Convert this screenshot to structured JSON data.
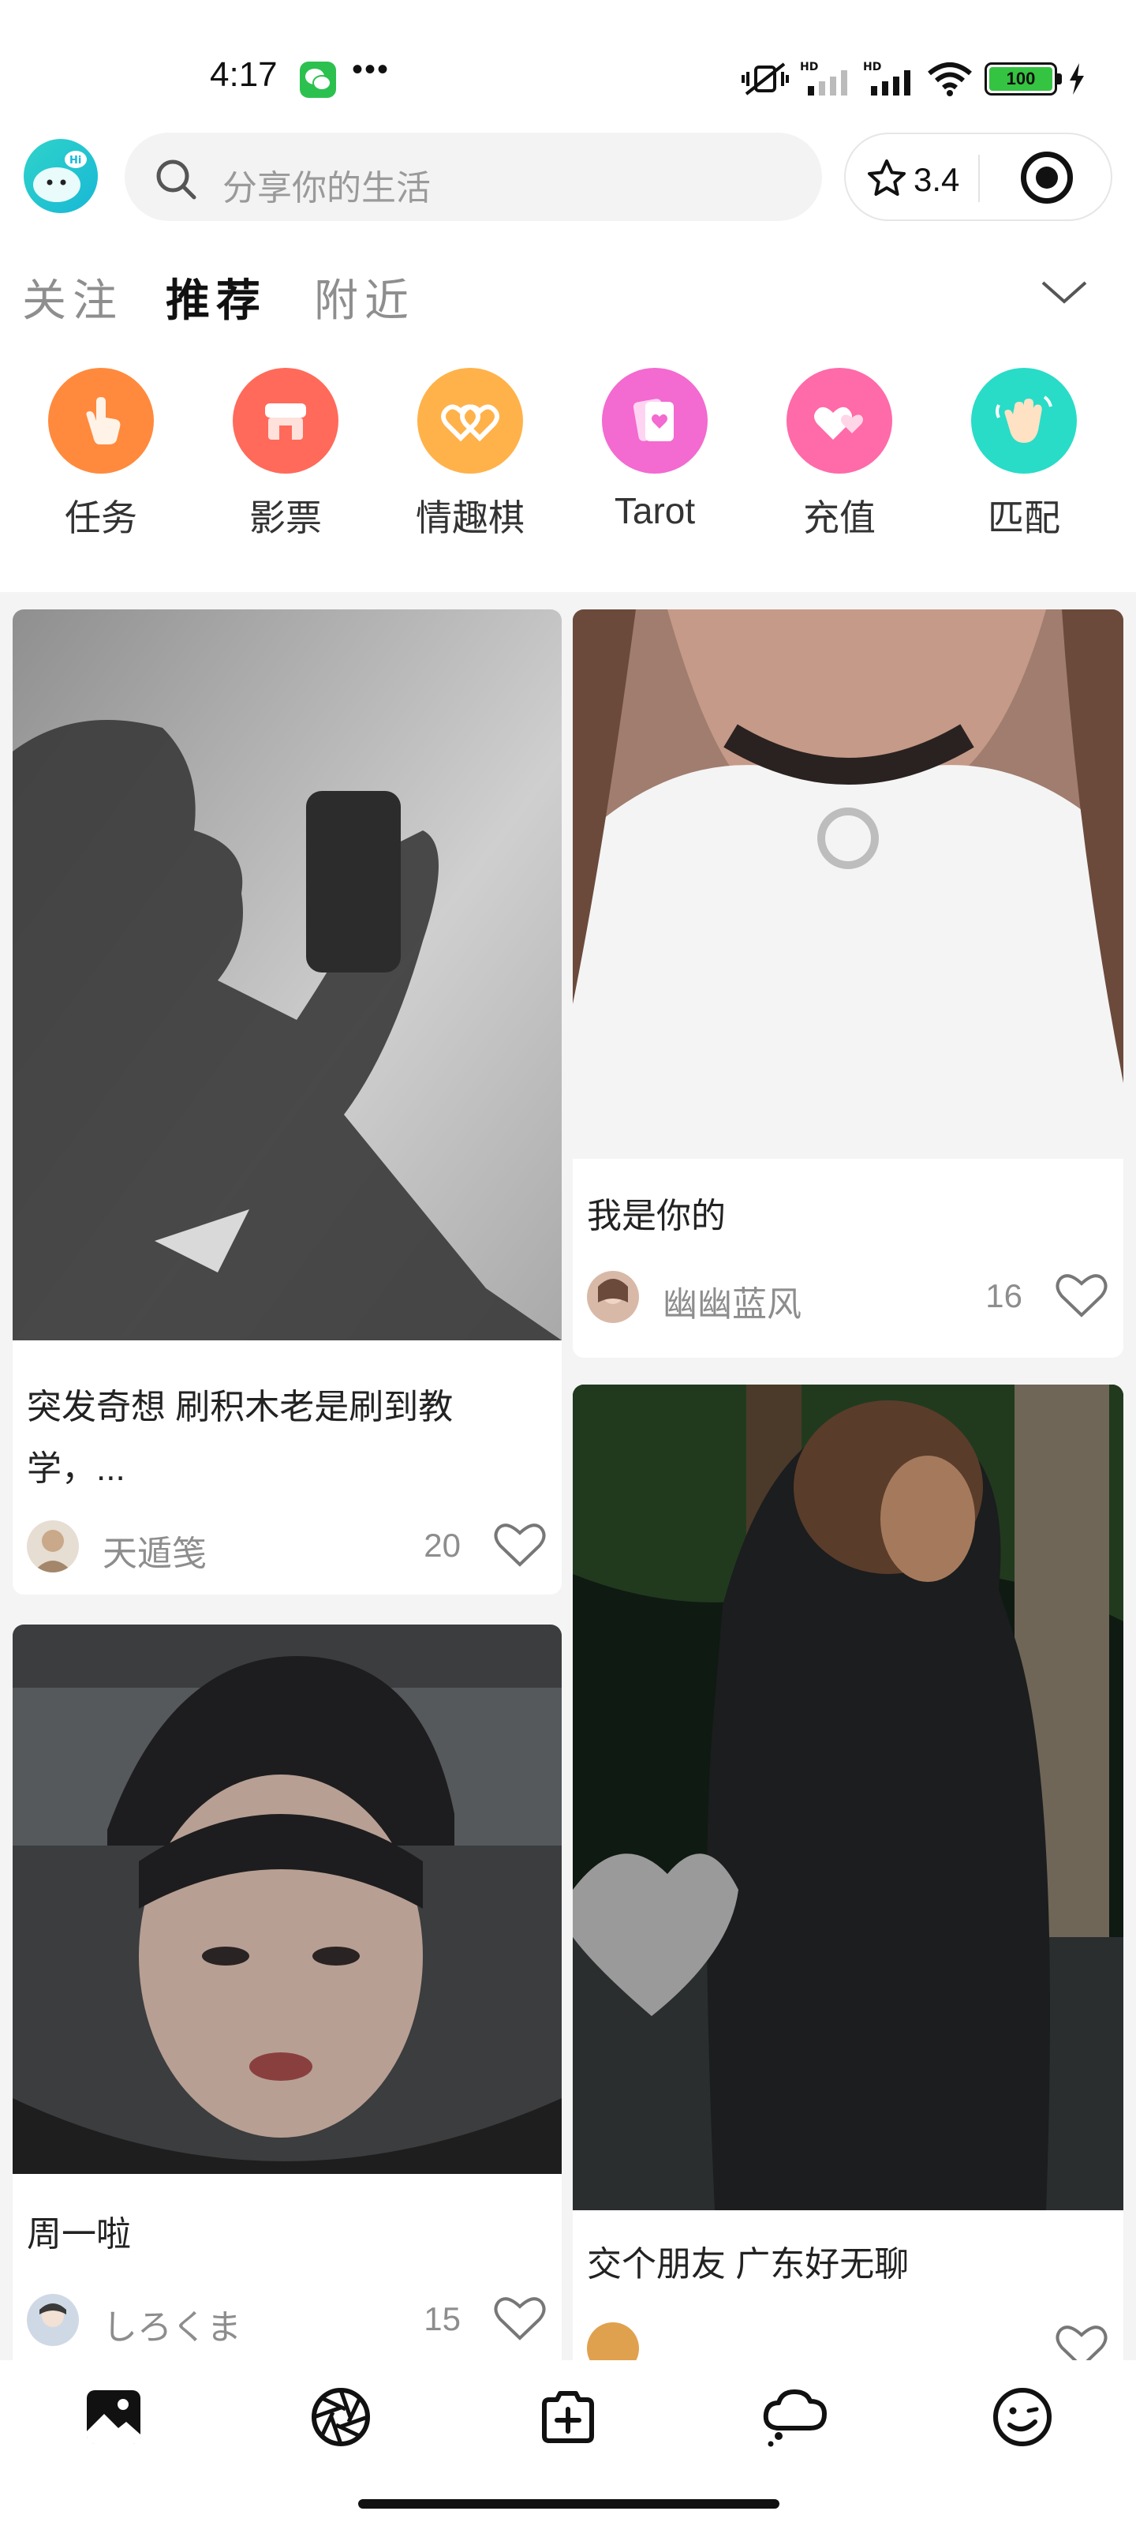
{
  "status_bar": {
    "time": "4:17",
    "dots": "•••",
    "battery": "100"
  },
  "header": {
    "search_placeholder": "分享你的生活",
    "rating": "3.4"
  },
  "tabs": [
    {
      "label": "关注",
      "active": false
    },
    {
      "label": "推荐",
      "active": true
    },
    {
      "label": "附近",
      "active": false
    }
  ],
  "categories": [
    {
      "label": "任务",
      "icon": "hand-pointer-icon",
      "color": "#ff8a3d"
    },
    {
      "label": "影票",
      "icon": "ticket-store-icon",
      "color": "#ff6a5a"
    },
    {
      "label": "情趣棋",
      "icon": "linked-hearts-icon",
      "color": "#ffb24a"
    },
    {
      "label": "Tarot",
      "icon": "tarot-card-icon",
      "color": "#f36ad0"
    },
    {
      "label": "充值",
      "icon": "hearts-icon",
      "color": "#ff6aa8"
    },
    {
      "label": "匹配",
      "icon": "waving-hand-icon",
      "color": "#29dcc7"
    }
  ],
  "feed": {
    "cards": [
      {
        "title": "突发奇想 刷积木老是刷到教学，...",
        "author": "天遁笺",
        "likes": "20"
      },
      {
        "title": "我是你的",
        "author": "幽幽蓝风",
        "likes": "16"
      },
      {
        "title": "周一啦",
        "author": "しろくま",
        "likes": "15"
      },
      {
        "title": "交个朋友 广东好无聊",
        "author": "",
        "likes": ""
      }
    ]
  },
  "bottom_nav": [
    {
      "name": "gallery-icon",
      "active": true
    },
    {
      "name": "aperture-icon",
      "active": false
    },
    {
      "name": "add-post-icon",
      "active": false
    },
    {
      "name": "chat-bubble-icon",
      "active": false
    },
    {
      "name": "smile-icon",
      "active": false
    }
  ]
}
